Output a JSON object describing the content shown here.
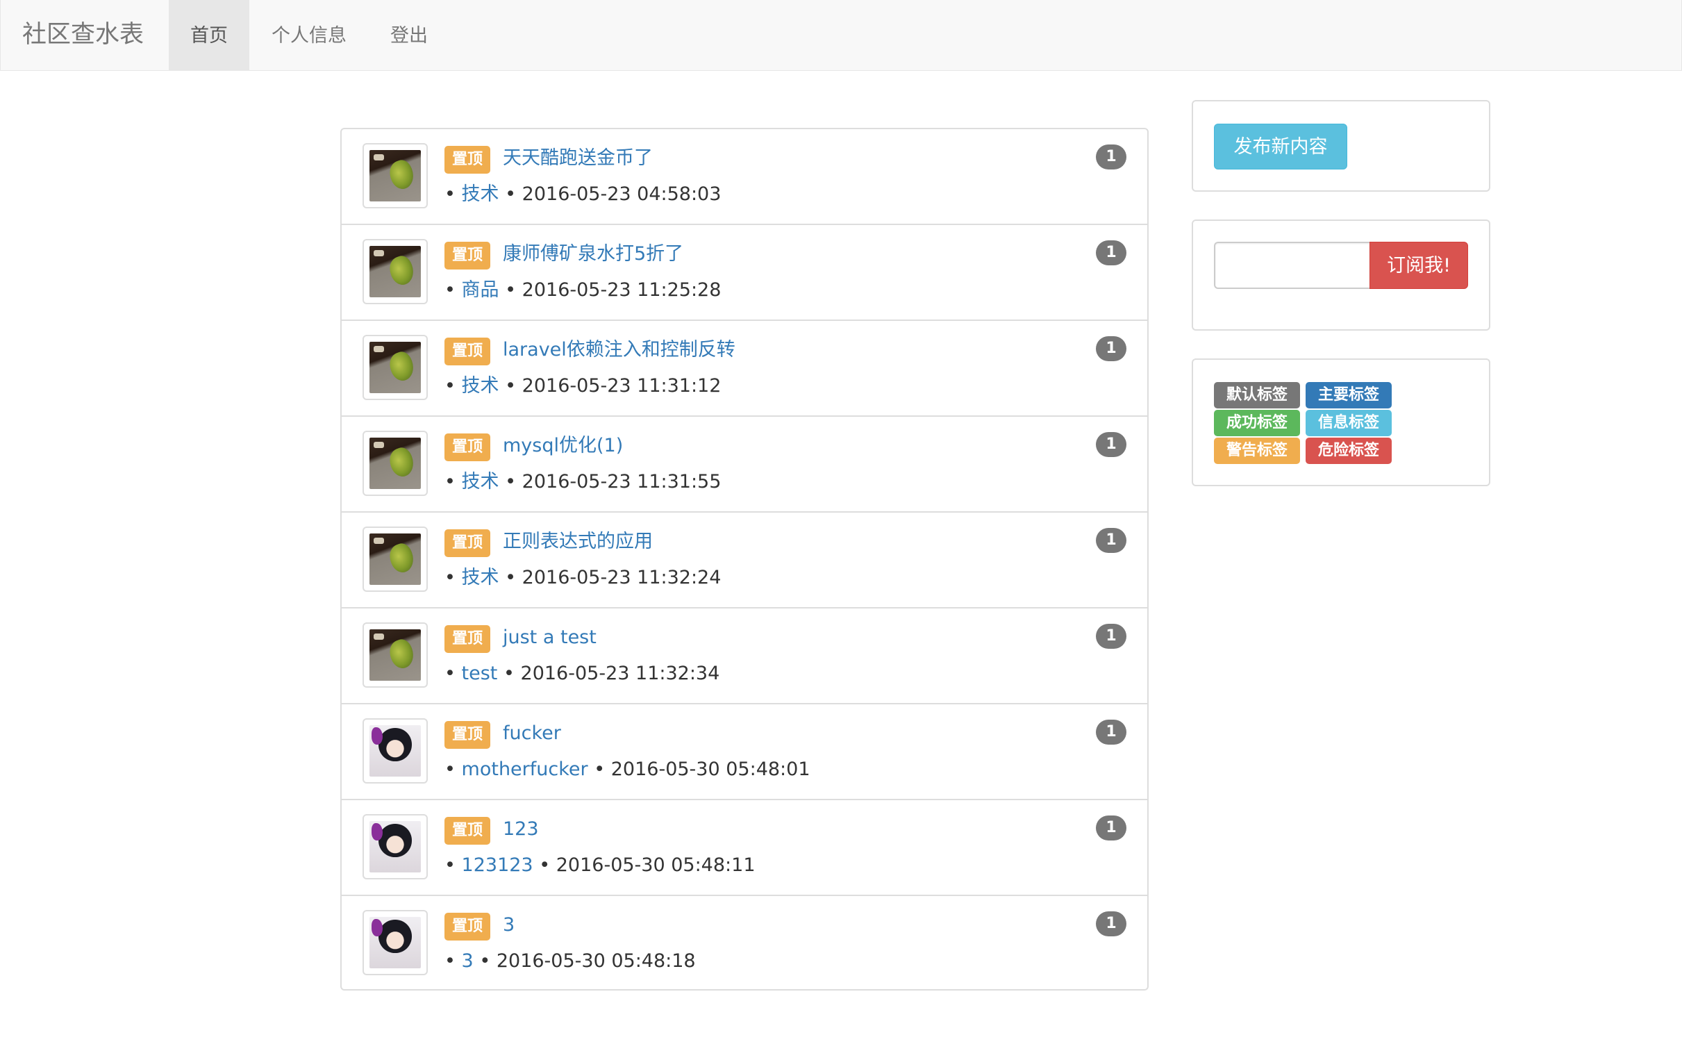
{
  "navbar": {
    "brand": "社区查水表",
    "items": [
      {
        "label": "首页",
        "active": true
      },
      {
        "label": "个人信息",
        "active": false
      },
      {
        "label": "登出",
        "active": false
      }
    ]
  },
  "posts": [
    {
      "pin": "置顶",
      "title": "天天酷跑送金币了",
      "category": "技术",
      "time": "2016-05-23 04:58:03",
      "count": "1",
      "avatar": "bird"
    },
    {
      "pin": "置顶",
      "title": "康师傅矿泉水打5折了",
      "category": "商品",
      "time": "2016-05-23 11:25:28",
      "count": "1",
      "avatar": "bird"
    },
    {
      "pin": "置顶",
      "title": "laravel依赖注入和控制反转",
      "category": "技术",
      "time": "2016-05-23 11:31:12",
      "count": "1",
      "avatar": "bird"
    },
    {
      "pin": "置顶",
      "title": "mysql优化(1)",
      "category": "技术",
      "time": "2016-05-23 11:31:55",
      "count": "1",
      "avatar": "bird"
    },
    {
      "pin": "置顶",
      "title": "正则表达式的应用",
      "category": "技术",
      "time": "2016-05-23 11:32:24",
      "count": "1",
      "avatar": "bird"
    },
    {
      "pin": "置顶",
      "title": "just a test",
      "category": "test",
      "time": "2016-05-23 11:32:34",
      "count": "1",
      "avatar": "bird"
    },
    {
      "pin": "置顶",
      "title": "fucker",
      "category": "motherfucker",
      "time": "2016-05-30 05:48:01",
      "count": "1",
      "avatar": "anime"
    },
    {
      "pin": "置顶",
      "title": "123",
      "category": "123123",
      "time": "2016-05-30 05:48:11",
      "count": "1",
      "avatar": "anime"
    },
    {
      "pin": "置顶",
      "title": "3",
      "category": "3",
      "time": "2016-05-30 05:48:18",
      "count": "1",
      "avatar": "anime"
    }
  ],
  "meta_separator": "•",
  "sidebar": {
    "publish_label": "发布新内容",
    "subscribe_value": "",
    "subscribe_label": "订阅我!",
    "tags": [
      {
        "label": "默认标签",
        "color": "#777777"
      },
      {
        "label": "主要标签",
        "color": "#337ab7"
      },
      {
        "label": "成功标签",
        "color": "#5cb85c"
      },
      {
        "label": "信息标签",
        "color": "#5bc0de"
      },
      {
        "label": "警告标签",
        "color": "#f0ad4e"
      },
      {
        "label": "危险标签",
        "color": "#d9534f"
      }
    ]
  }
}
